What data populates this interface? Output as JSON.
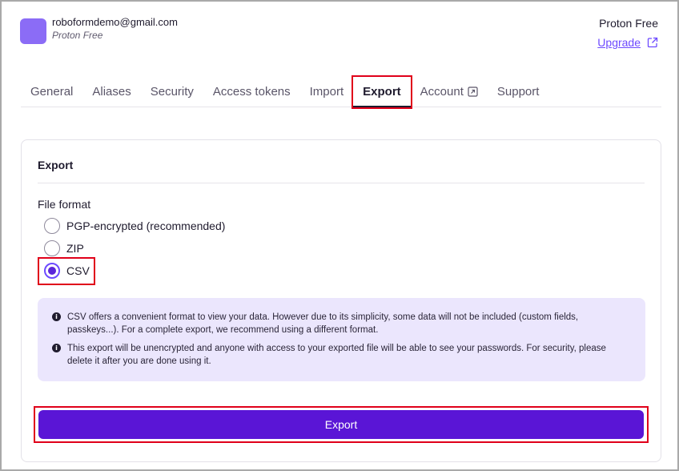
{
  "account": {
    "email": "roboformdemo@gmail.com",
    "plan_sub": "Proton Free",
    "plan_name": "Proton Free",
    "upgrade_label": "Upgrade"
  },
  "tabs": [
    {
      "label": "General"
    },
    {
      "label": "Aliases"
    },
    {
      "label": "Security"
    },
    {
      "label": "Access tokens"
    },
    {
      "label": "Import"
    },
    {
      "label": "Export",
      "active": true
    },
    {
      "label": "Account",
      "external": true
    },
    {
      "label": "Support"
    }
  ],
  "export": {
    "title": "Export",
    "file_format_label": "File format",
    "options": [
      {
        "label": "PGP-encrypted (recommended)",
        "checked": false
      },
      {
        "label": "ZIP",
        "checked": false
      },
      {
        "label": "CSV",
        "checked": true
      }
    ],
    "notices": [
      "CSV offers a convenient format to view your data. However due to its simplicity, some data will not be included (custom fields, passkeys...). For a complete export, we recommend using a different format.",
      "This export will be unencrypted and anyone with access to your exported file will be able to see your passwords. For security, please delete it after you are done using it."
    ],
    "button_label": "Export"
  },
  "icons": {
    "info": "info-icon",
    "external_link": "external-link-icon"
  },
  "colors": {
    "accent": "#6d4aff",
    "button": "#5a15d6",
    "avatar": "#8b6cf6",
    "notice_bg": "#ebe6fd",
    "highlight": "#e0001a"
  }
}
